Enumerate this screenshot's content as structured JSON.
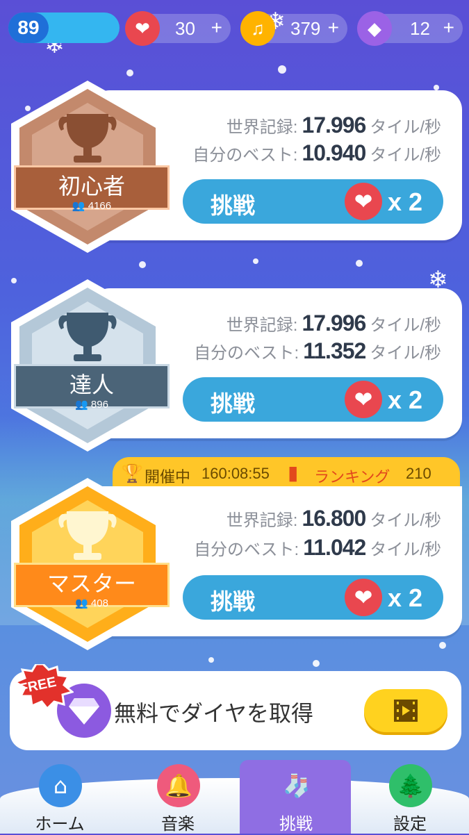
{
  "topbar": {
    "level": "89",
    "hearts": "30",
    "notes": "379",
    "diamonds": "12",
    "plus": "+"
  },
  "stat_labels": {
    "world_record": "世界記録:",
    "personal_best": "自分のベスト:",
    "unit": "タイル/秒"
  },
  "challenges": [
    {
      "rank": "初心者",
      "players": "4166",
      "world_record": "17.996",
      "personal_best": "10.940",
      "button": "挑戦",
      "cost": "x 2"
    },
    {
      "rank": "達人",
      "players": "896",
      "world_record": "17.996",
      "personal_best": "11.352",
      "button": "挑戦",
      "cost": "x 2"
    },
    {
      "rank": "マスター",
      "players": "408",
      "world_record": "16.800",
      "personal_best": "11.042",
      "button": "挑戦",
      "cost": "x 2"
    }
  ],
  "event": {
    "status": "開催中",
    "timer": "160:08:55",
    "ranking_label": "ランキング",
    "ranking_value": "210"
  },
  "free_offer": {
    "badge": "FREE",
    "text": "無料でダイヤを取得"
  },
  "nav": [
    {
      "label": "ホーム",
      "icon": "home-icon",
      "color": "#3b8fe6"
    },
    {
      "label": "音楽",
      "icon": "bell-icon",
      "color": "#ef5a7c"
    },
    {
      "label": "挑戦",
      "icon": "stocking-icon",
      "color": "#8f6ee3"
    },
    {
      "label": "設定",
      "icon": "tree-icon",
      "color": "#2fbf6a"
    }
  ],
  "colors": {
    "bronze": "#b06a48",
    "silver": "#4b6478",
    "gold": "#ff9a1e",
    "challenge_button": "#3aa7dc",
    "heart": "#e9474f"
  }
}
